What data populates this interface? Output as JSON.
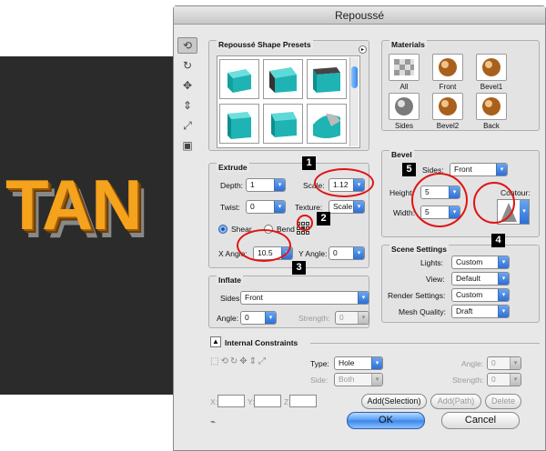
{
  "canvas_text": "TAN",
  "dialog": {
    "title": "Repoussé"
  },
  "presets": {
    "title": "Repoussé Shape Presets"
  },
  "materials": {
    "title": "Materials",
    "items": [
      {
        "label": "All",
        "icon": "checker-material-icon"
      },
      {
        "label": "Front",
        "icon": "sphere-material-icon"
      },
      {
        "label": "Bevel1",
        "icon": "sphere-material-icon"
      },
      {
        "label": "Sides",
        "icon": "sphere-material-icon"
      },
      {
        "label": "Bevel2",
        "icon": "sphere-material-icon"
      },
      {
        "label": "Back",
        "icon": "sphere-material-icon"
      }
    ]
  },
  "extrude": {
    "title": "Extrude",
    "depth_label": "Depth:",
    "depth_value": "1",
    "scale_label": "Scale:",
    "scale_value": "1.12",
    "twist_label": "Twist:",
    "twist_value": "0",
    "texture_label": "Texture:",
    "texture_value": "Scale",
    "shear_label": "Shear",
    "bend_label": "Bend",
    "xangle_label": "X Angle:",
    "xangle_value": "10.5",
    "yangle_label": "Y Angle:",
    "yangle_value": "0"
  },
  "bevel": {
    "title": "Bevel",
    "sides_label": "Sides:",
    "sides_value": "Front",
    "height_label": "Height:",
    "height_value": "5",
    "width_label": "Width:",
    "width_value": "5",
    "contour_label": "Contour:"
  },
  "inflate": {
    "title": "Inflate",
    "sides_label": "Sides:",
    "sides_value": "Front",
    "angle_label": "Angle:",
    "angle_value": "0",
    "strength_label": "Strength:",
    "strength_value": "0"
  },
  "scene": {
    "title": "Scene Settings",
    "lights_label": "Lights:",
    "lights_value": "Custom",
    "view_label": "View:",
    "view_value": "Default",
    "render_label": "Render Settings:",
    "render_value": "Custom",
    "mesh_label": "Mesh Quality:",
    "mesh_value": "Draft"
  },
  "constraints": {
    "title": "Internal Constraints",
    "type_label": "Type:",
    "type_value": "Hole",
    "side_label": "Side:",
    "side_value": "Both",
    "angle_label": "Angle:",
    "angle_value": "0",
    "strength_label": "Strength:",
    "strength_value": "0",
    "x_label": "X:",
    "y_label": "Y:",
    "z_label": "Z:",
    "add_selection": "Add(Selection)",
    "add_path": "Add(Path)",
    "delete": "Delete"
  },
  "buttons": {
    "ok": "OK",
    "cancel": "Cancel"
  },
  "callouts": [
    "1",
    "2",
    "3",
    "4",
    "5"
  ],
  "colors": {
    "accent": "#3a86ec",
    "annotation": "#e01515",
    "preset_teal": "#1fb3b3"
  }
}
